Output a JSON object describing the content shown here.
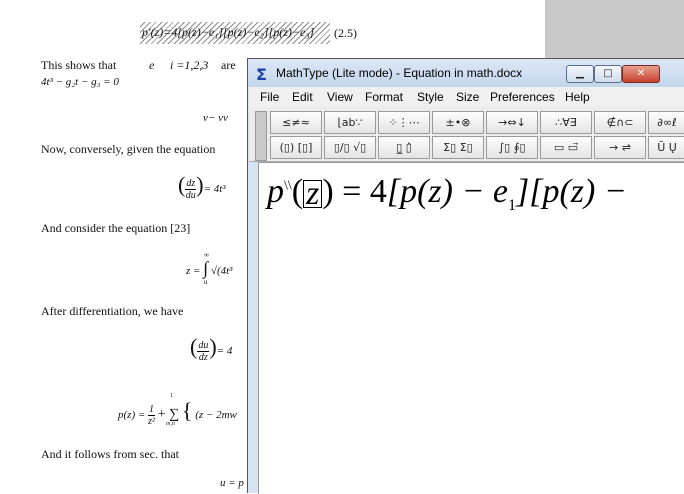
{
  "document": {
    "eq_2_5_label": "(2.5)",
    "eq_2_5_visible": "p′(z)=4[p(z)−e₁][p(z)−e₂][p(z)−e₃]",
    "para1_start": "This shows that",
    "para1_e": "e",
    "para1_i": "i =1,2,3",
    "para1_are": "are",
    "cubic": "4t³ − g₂t − g₃ = 0",
    "eq_v": "v",
    "eq_v_rest": "− vv",
    "para2": "Now, conversely, given the equation",
    "eq_dz_du_num": "dz",
    "eq_dz_du_den": "du",
    "eq_dz_du_rest": "= 4t³",
    "para3": "And consider the equation [23]",
    "eq_z": "z =",
    "eq_z_integral": "∫",
    "eq_z_inf": "∞",
    "eq_z_zero": "u",
    "eq_z_sqrt": "√(4t³",
    "para4": "After differentiation, we have",
    "eq_du_dz_num": "du",
    "eq_du_dz_den": "dz",
    "eq_du_dz_rest": "= 4",
    "eq_pz": "p(z) =",
    "eq_pz_frac_num": "1",
    "eq_pz_frac_den": "z²",
    "eq_pz_sum": "+ ∑",
    "eq_pz_sum_sub": "m,n",
    "eq_pz_sum_sup": "1",
    "eq_pz_rest": "(z − 2mw",
    "para5": "And it follows from sec. that",
    "eq_u": "u = p"
  },
  "mathtype": {
    "title": "MathType (Lite mode) - Equation in math.docx",
    "title_icon": "sigma-icon",
    "buttons": {
      "minimize": "▁",
      "maximize": "□",
      "close": "✕"
    },
    "menus": [
      "File",
      "Edit",
      "View",
      "Format",
      "Style",
      "Size",
      "Preferences",
      "Help"
    ],
    "toolbar_row1": [
      "≤≠≈",
      "⌊ab∵",
      "⁘⋮⋯",
      "±•⊗",
      "→⇔↓",
      "∴∀∃",
      "∉∩⊂",
      "∂∞ℓ"
    ],
    "toolbar_row2": [
      "(▯) [▯]",
      "▯/▯ √▯",
      "▯̲ ▯̂",
      "Σ▯ Σ▯",
      "∫▯ ∮▯",
      "▭ ▭⃗",
      "→ ⇌",
      "Ū Ų"
    ],
    "equation": {
      "p": "p",
      "prime": "\\\\",
      "z_arg": "z",
      "eq_four": ") = 4",
      "term1": "[p(z) − e",
      "sub1": "1",
      "term2": "][p(z) −"
    }
  }
}
